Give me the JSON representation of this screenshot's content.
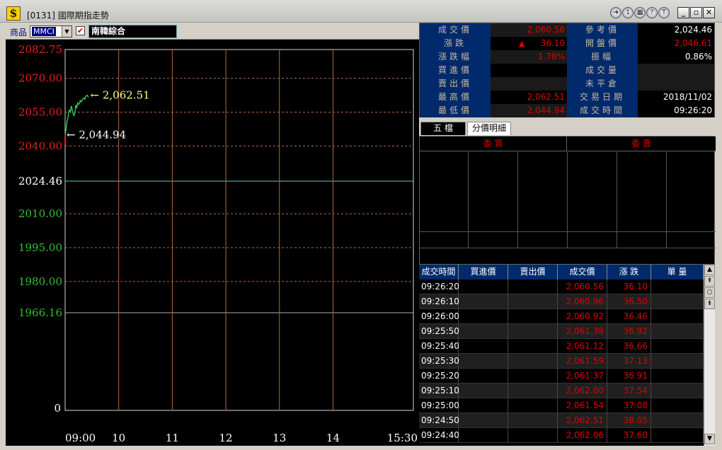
{
  "window": {
    "title": "[0131] 國際期指走勢"
  },
  "icons": {
    "app": "dollar-app-icon",
    "ctrl1": "arrow-right-circle-icon",
    "ctrl2": "number-one-circle-icon",
    "ctrl3": "calendar-circle-icon",
    "ctrl4": "question-circle-icon",
    "ctrl5": "letter-t-circle-icon",
    "min": "minimize-icon",
    "max": "maximize-icon",
    "close": "close-icon"
  },
  "toolbar": {
    "product_label": "商品",
    "product_code": "MMCI",
    "index_name": "南韓綜合"
  },
  "chart_data": {
    "type": "line",
    "y_labels": [
      {
        "value": 2082.75,
        "text": "2082.75",
        "color": "#e02020"
      },
      {
        "value": 2070,
        "text": "2070.00",
        "color": "#e02020"
      },
      {
        "value": 2055,
        "text": "2055.00",
        "color": "#e02020"
      },
      {
        "value": 2040,
        "text": "2040.00",
        "color": "#e02020"
      },
      {
        "value": 2024.46,
        "text": "2024.46",
        "color": "#ffffff"
      },
      {
        "value": 2010,
        "text": "2010.00",
        "color": "#30c030"
      },
      {
        "value": 1995,
        "text": "1995.00",
        "color": "#30c030"
      },
      {
        "value": 1980,
        "text": "1980.00",
        "color": "#30c030"
      },
      {
        "value": 1966.16,
        "text": "1966.16",
        "color": "#30c030"
      }
    ],
    "volume_zero_label": "0",
    "x_labels": [
      {
        "minutes": 0,
        "text": "09:00"
      },
      {
        "minutes": 60,
        "text": "10"
      },
      {
        "minutes": 120,
        "text": "11"
      },
      {
        "minutes": 180,
        "text": "12"
      },
      {
        "minutes": 240,
        "text": "13"
      },
      {
        "minutes": 300,
        "text": "14"
      },
      {
        "minutes": 390,
        "text": "15:30"
      }
    ],
    "session_minutes": 390,
    "reference": 2024.46,
    "high_annotation": "2,062.51",
    "low_annotation": "2,044.94",
    "high": 2062.51,
    "low": 2044.94,
    "points": [
      [
        0,
        2044.94
      ],
      [
        1,
        2047.2
      ],
      [
        2,
        2050.5
      ],
      [
        3,
        2052.1
      ],
      [
        4,
        2055.3
      ],
      [
        5,
        2056.0
      ],
      [
        6,
        2055.2
      ],
      [
        7,
        2057.8
      ],
      [
        8,
        2056.1
      ],
      [
        9,
        2054.0
      ],
      [
        10,
        2053.5
      ],
      [
        11,
        2054.8
      ],
      [
        12,
        2058.2
      ],
      [
        13,
        2057.0
      ],
      [
        14,
        2059.1
      ],
      [
        15,
        2058.4
      ],
      [
        16,
        2058.9
      ],
      [
        17,
        2060.2
      ],
      [
        18,
        2059.6
      ],
      [
        19,
        2060.4
      ],
      [
        20,
        2060.8
      ],
      [
        21,
        2061.3
      ],
      [
        22,
        2060.7
      ],
      [
        23,
        2061.9
      ],
      [
        24,
        2062.3
      ],
      [
        25,
        2062.51
      ],
      [
        26,
        2061.6
      ]
    ]
  },
  "quote": {
    "left": [
      {
        "label": "成交價",
        "value": "2,060.56"
      },
      {
        "label": "漲跌",
        "value": "36.10",
        "up": true
      },
      {
        "label": "漲跌幅",
        "value": "1.78%"
      },
      {
        "label": "買進價",
        "value": ""
      },
      {
        "label": "賣出價",
        "value": ""
      },
      {
        "label": "最高價",
        "value": "2,062.51"
      },
      {
        "label": "最低價",
        "value": "2,044.94"
      }
    ],
    "right": [
      {
        "label": "參考價",
        "value": "2,024.46",
        "color": "#ffffff"
      },
      {
        "label": "開盤價",
        "value": "2,046.61",
        "color": "#e00000"
      },
      {
        "label": "振幅",
        "value": "0.86%",
        "color": "#ffffff"
      },
      {
        "label": "成交量",
        "value": "",
        "color": "#ffffff"
      },
      {
        "label": "未平倉",
        "value": "",
        "color": "#ffffff"
      },
      {
        "label": "交易日期",
        "value": "2018/11/02",
        "color": "#ffffff"
      },
      {
        "label": "成交時間",
        "value": "09:26:20",
        "color": "#ffffff"
      }
    ]
  },
  "tabs": {
    "five": "五 檔",
    "detail": "分價明細"
  },
  "depth": {
    "buy": "委 買",
    "sell": "委 賣"
  },
  "trades": {
    "headers": [
      "成交時間",
      "買進價",
      "賣出價",
      "成交價",
      "漲 跌",
      "單 量"
    ],
    "rows": [
      [
        "09:26:20",
        "",
        "",
        "2,060.56",
        "36.10",
        ""
      ],
      [
        "09:26:10",
        "",
        "",
        "2,060.96",
        "36.50",
        ""
      ],
      [
        "09:26:00",
        "",
        "",
        "2,060.92",
        "36.46",
        ""
      ],
      [
        "09:25:50",
        "",
        "",
        "2,061.38",
        "36.92",
        ""
      ],
      [
        "09:25:40",
        "",
        "",
        "2,061.12",
        "36.66",
        ""
      ],
      [
        "09:25:30",
        "",
        "",
        "2,061.59",
        "37.13",
        ""
      ],
      [
        "09:25:20",
        "",
        "",
        "2,061.37",
        "36.91",
        ""
      ],
      [
        "09:25:10",
        "",
        "",
        "2,062.00",
        "37.54",
        ""
      ],
      [
        "09:25:00",
        "",
        "",
        "2,061.54",
        "37.08",
        ""
      ],
      [
        "09:24:50",
        "",
        "",
        "2,062.51",
        "38.05",
        ""
      ],
      [
        "09:24:40",
        "",
        "",
        "2,062.06",
        "37.60",
        ""
      ]
    ]
  }
}
